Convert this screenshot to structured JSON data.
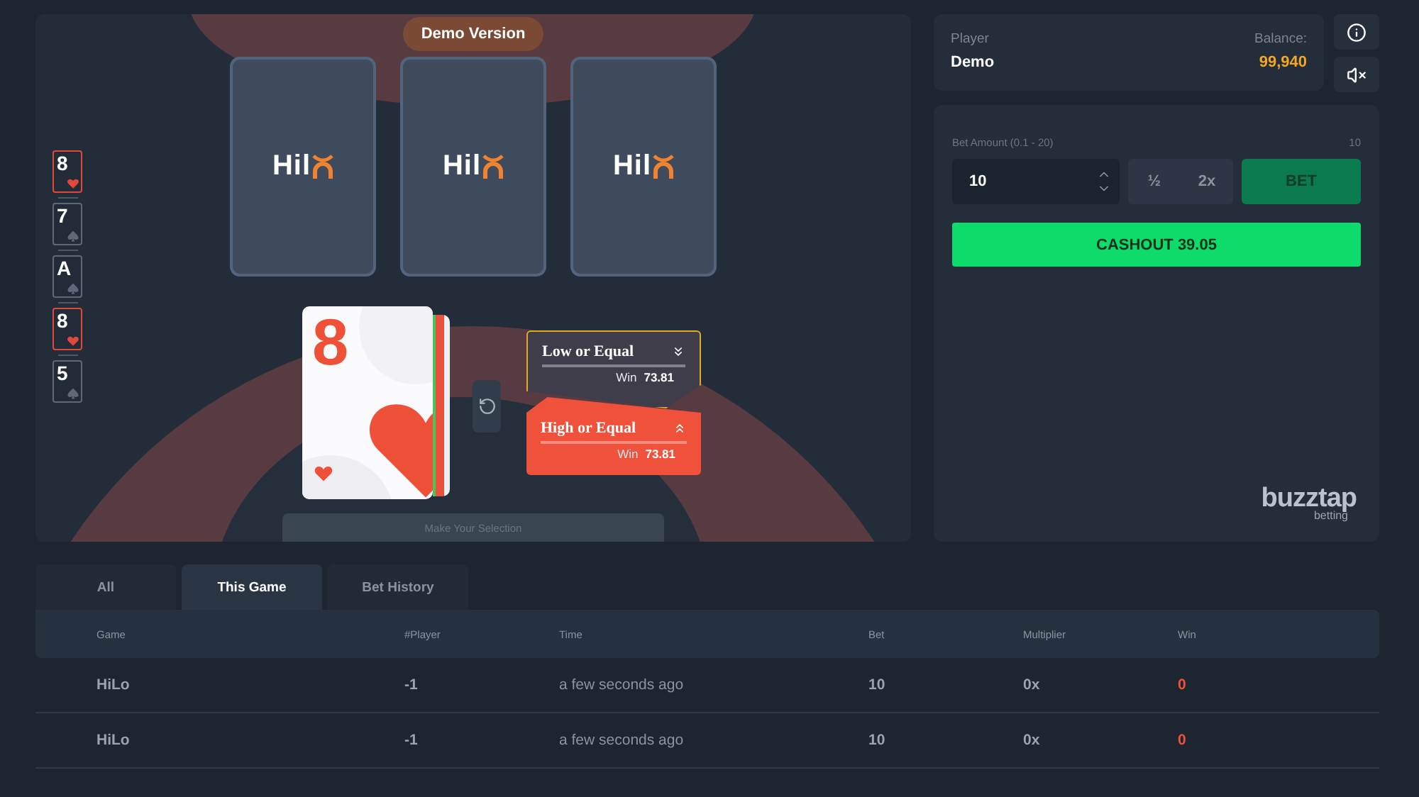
{
  "game": {
    "badge": "Demo Version",
    "card_backs": [
      {
        "logo": "Hil"
      },
      {
        "logo": "Hil"
      },
      {
        "logo": "Hil"
      }
    ],
    "history": [
      {
        "rank": "8",
        "kind": "hearts"
      },
      {
        "rank": "7",
        "kind": "spades"
      },
      {
        "rank": "A",
        "kind": "spades"
      },
      {
        "rank": "8",
        "kind": "hearts"
      },
      {
        "rank": "5",
        "kind": "spades"
      }
    ],
    "current_card": {
      "rank": "8",
      "kind": "hearts"
    },
    "choices": [
      {
        "kind": "low",
        "label": "Low or Equal",
        "win_label": "Win",
        "win": "73.81",
        "highlighted": true
      },
      {
        "kind": "high",
        "label": "High or Equal",
        "win_label": "Win",
        "win": "73.81",
        "highlighted": false
      }
    ],
    "prompt": "Make Your Selection"
  },
  "player": {
    "label": "Player",
    "name": "Demo",
    "balance_label": "Balance:",
    "balance": "99,940",
    "muted": true
  },
  "bet": {
    "label": "Bet Amount (0.1 - 20)",
    "max": "10",
    "value": "10",
    "half": "½",
    "double": "2x",
    "bet_button": "BET",
    "bet_disabled": true,
    "cashout": "CASHOUT 39.05"
  },
  "brand": {
    "name": "buzztap",
    "tagline": "betting"
  },
  "tabs": [
    {
      "label": "All",
      "selected": false
    },
    {
      "label": "This Game",
      "selected": true
    },
    {
      "label": "Bet History",
      "selected": false
    }
  ],
  "table": {
    "columns": [
      "Game",
      "#Player",
      "Time",
      "Bet",
      "Multiplier",
      "Win"
    ],
    "rows": [
      {
        "cells": [
          "HiLo",
          "-1",
          "a few seconds ago",
          "10",
          "0x",
          "0"
        ]
      },
      {
        "cells": [
          "HiLo",
          "-1",
          "a few seconds ago",
          "10",
          "0x",
          "0"
        ]
      }
    ]
  }
}
